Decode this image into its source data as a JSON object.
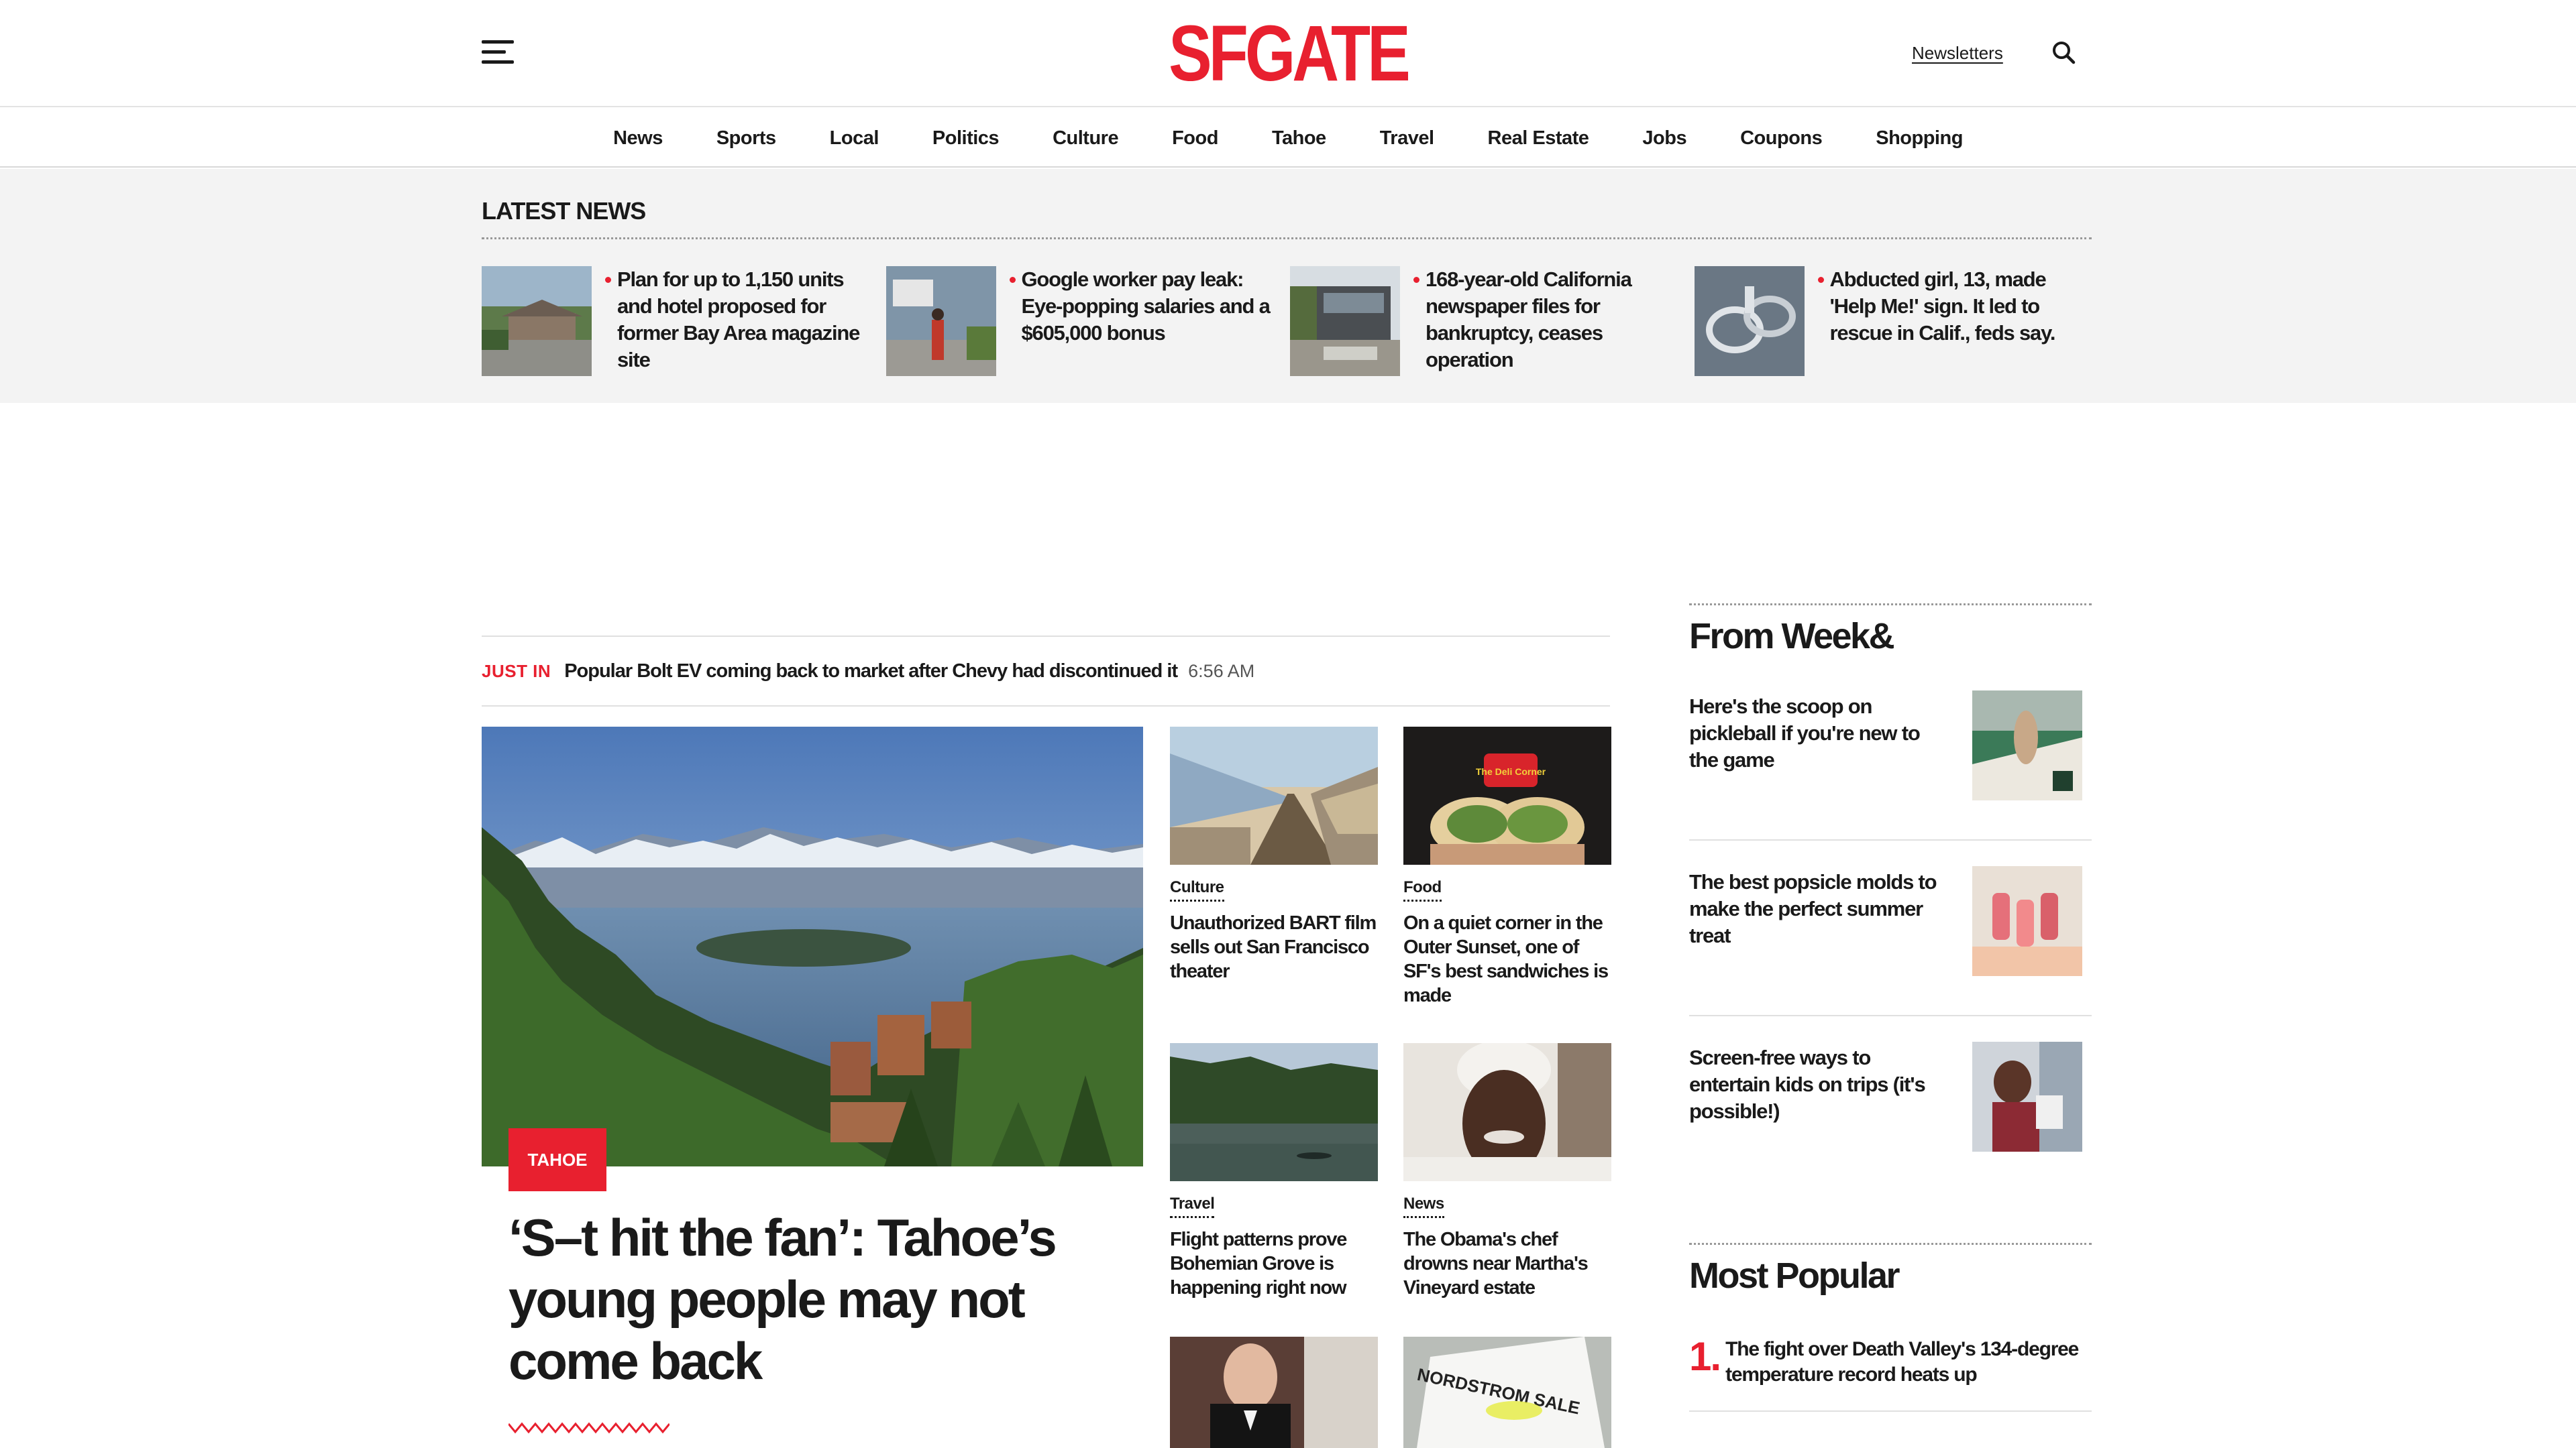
{
  "header": {
    "logo": "SFGATE",
    "newsletters_label": "Newsletters",
    "menu_icon": "hamburger-menu-icon",
    "search_icon": "search-icon"
  },
  "nav": {
    "items": [
      "News",
      "Sports",
      "Local",
      "Politics",
      "Culture",
      "Food",
      "Tahoe",
      "Travel",
      "Real Estate",
      "Jobs",
      "Coupons",
      "Shopping"
    ]
  },
  "latest": {
    "title": "LATEST NEWS",
    "items": [
      {
        "headline": "Plan for up to 1,150 units and hotel proposed for former Bay Area magazine site"
      },
      {
        "headline": "Google worker pay leak: Eye-popping salaries and a $605,000 bonus"
      },
      {
        "headline": "168-year-old California newspaper files for bankruptcy, ceases operation"
      },
      {
        "headline": "Abducted girl, 13, made 'Help Me!' sign. It led to rescue in Calif., feds say."
      }
    ]
  },
  "just_in": {
    "label": "JUST IN",
    "headline": "Popular Bolt EV coming back to market after Chevy had discontinued it",
    "time": "6:56 AM"
  },
  "hero": {
    "tag": "TAHOE",
    "title": "‘S–t hit the fan’: Tahoe’s young people may not come back"
  },
  "cards": [
    {
      "category": "Culture",
      "title": "Unauthorized BART film sells out San Francisco theater"
    },
    {
      "category": "Food",
      "title": "On a quiet corner in the Outer Sunset, one of SF's best sandwiches is made",
      "sign_text": "The Deli Corner"
    },
    {
      "category": "Travel",
      "title": "Flight patterns prove Bohemian Grove is happening right now"
    },
    {
      "category": "News",
      "title": "The Obama's chef drowns near Martha's Vineyard estate"
    },
    {
      "category": "",
      "title": ""
    },
    {
      "category": "",
      "title": "",
      "sign_text": "NORDSTROM SALE"
    }
  ],
  "week": {
    "title": "From Week&",
    "items": [
      {
        "headline": "Here's the scoop on pickleball if you're new to the game"
      },
      {
        "headline": "The best popsicle molds to make the perfect summer treat"
      },
      {
        "headline": "Screen-free ways to entertain kids on trips (it's possible!)"
      }
    ]
  },
  "popular": {
    "title": "Most Popular",
    "items": [
      {
        "rank": "1.",
        "headline": "The fight over Death Valley's 134-degree temperature record heats up"
      }
    ]
  },
  "colors": {
    "brand_red": "#e8202f",
    "latest_bg": "#f3f3f3",
    "text": "#1a1a1a"
  }
}
